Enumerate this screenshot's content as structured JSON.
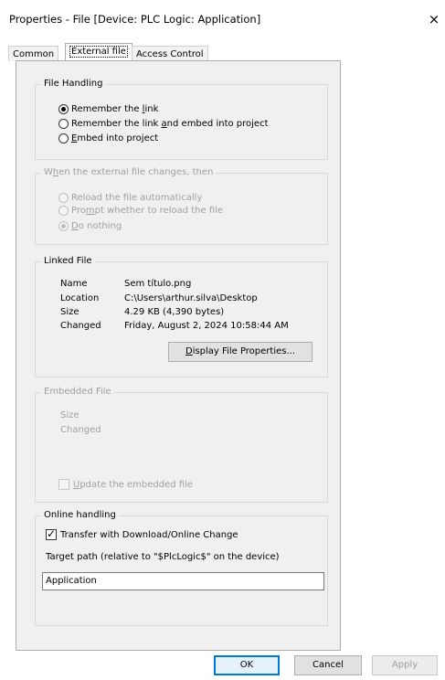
{
  "window": {
    "title": "Properties - File [Device: PLC Logic: Application]",
    "close_glyph": "×"
  },
  "tabs": [
    {
      "label": "Common"
    },
    {
      "label": "External file"
    },
    {
      "label": "Access Control"
    }
  ],
  "file_handling": {
    "title": "File Handling",
    "options": [
      {
        "pre": "Remember the ",
        "u": "l",
        "post": "ink",
        "checked": true
      },
      {
        "pre": "Remember the link ",
        "u": "a",
        "post": "nd embed into project",
        "checked": false
      },
      {
        "pre": "",
        "u": "E",
        "post": "mbed into project",
        "checked": false
      }
    ]
  },
  "external_changes": {
    "title_pre": "W",
    "title_u": "h",
    "title_post": "en the external file changes, then",
    "options": [
      {
        "pre": "Reload the file automatically",
        "u": "",
        "post": "",
        "checked": false
      },
      {
        "pre": "Pro",
        "u": "m",
        "post": "pt whether to reload the file",
        "checked": false
      },
      {
        "pre": "",
        "u": "D",
        "post": "o nothing",
        "checked": true
      }
    ]
  },
  "linked_file": {
    "title": "Linked File",
    "name_label": "Name",
    "name_value": "Sem título.png",
    "location_label": "Location",
    "location_value": "C:\\Users\\arthur.silva\\Desktop",
    "size_label": "Size",
    "size_value": "4.29 KB (4,390 bytes)",
    "changed_label": "Changed",
    "changed_value": "Friday, August 2, 2024 10:58:44 AM",
    "display_btn_u": "D",
    "display_btn_rest": "isplay File Properties..."
  },
  "embedded_file": {
    "title": "Embedded File",
    "size_label": "Size",
    "changed_label": "Changed",
    "update_u": "U",
    "update_rest": "pdate the embedded file"
  },
  "online_handling": {
    "title": "Online handling",
    "transfer_label": "Transfer with Download/Online Change",
    "transfer_checked": true,
    "target_label": "Target path (relative to \"$PlcLogic$\" on the device)",
    "target_value": "Application"
  },
  "buttons": {
    "ok": "OK",
    "cancel": "Cancel",
    "apply": "Apply"
  }
}
